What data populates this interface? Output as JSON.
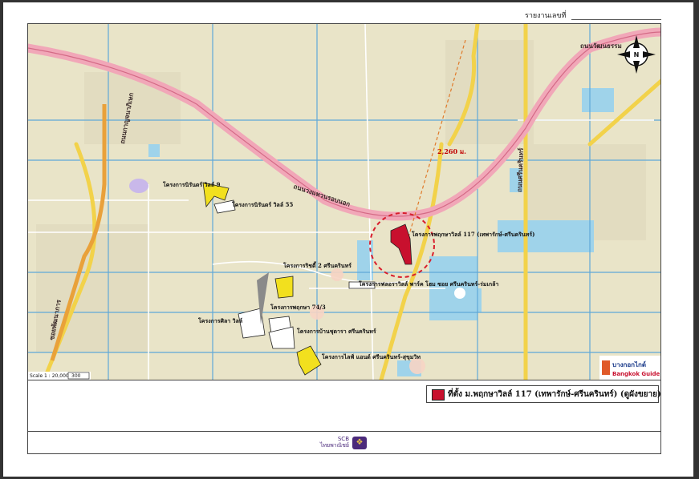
{
  "header": {
    "report_no_label": "รายงานเลขที่"
  },
  "map": {
    "ring_road_label": "ถนนวงแหวนรอบนอก",
    "road_labels": [
      "ถนนกาญจนาภิเษก",
      "ซอยพัฒนาการ",
      "ถนนวัฒนธรรม",
      "ถนนศรีนครินทร์"
    ],
    "distance_label": "2,260 ม.",
    "compass_label": "N",
    "scale_label": "Scale 1 : 20,000",
    "scale_bar_label": "300",
    "brand_label": "บางกอกไกด์",
    "brand_sub_label": "Bangkok Guide",
    "subject_project_label": "โครงการพฤกษาวิลล์ 117 (เทพารักษ์-ศรีนครินทร์)",
    "projects": [
      "โครงการนิรันดร์ วิลล์ 9",
      "โครงการนิรันดร์ วิลล์ 55",
      "โครงการริชดี้ 2 ศรีนครินทร์",
      "โครงการฟลอราวิลล์ พาร์ค โฮม ซอย ศรีนครินทร์-ร่มเกล้า",
      "โครงการพฤกษา 74/3",
      "โครงการศิลา วิลล์",
      "โครงการบ้านชุดารา ศรีนครินทร์",
      "โครงการไลฟ์ แอนด์ ศรีนครินทร์-สุขุมวิท"
    ]
  },
  "legend": {
    "subject_label": "ที่ตั้ง ม.พฤกษาวิลล์ 117 (เทพารักษ์-ศรีนครินทร์)  (ดูผังขยาย)"
  },
  "footer": {
    "bank_name_en": "SCB",
    "bank_name_th": "ไทยพาณิชย์"
  },
  "colors": {
    "ring_road": "#f1a7b8",
    "subject_site": "#c8102e",
    "comparable_project": "#f2e01e",
    "water": "#9fd3ea",
    "canal": "#5fa8d8"
  }
}
